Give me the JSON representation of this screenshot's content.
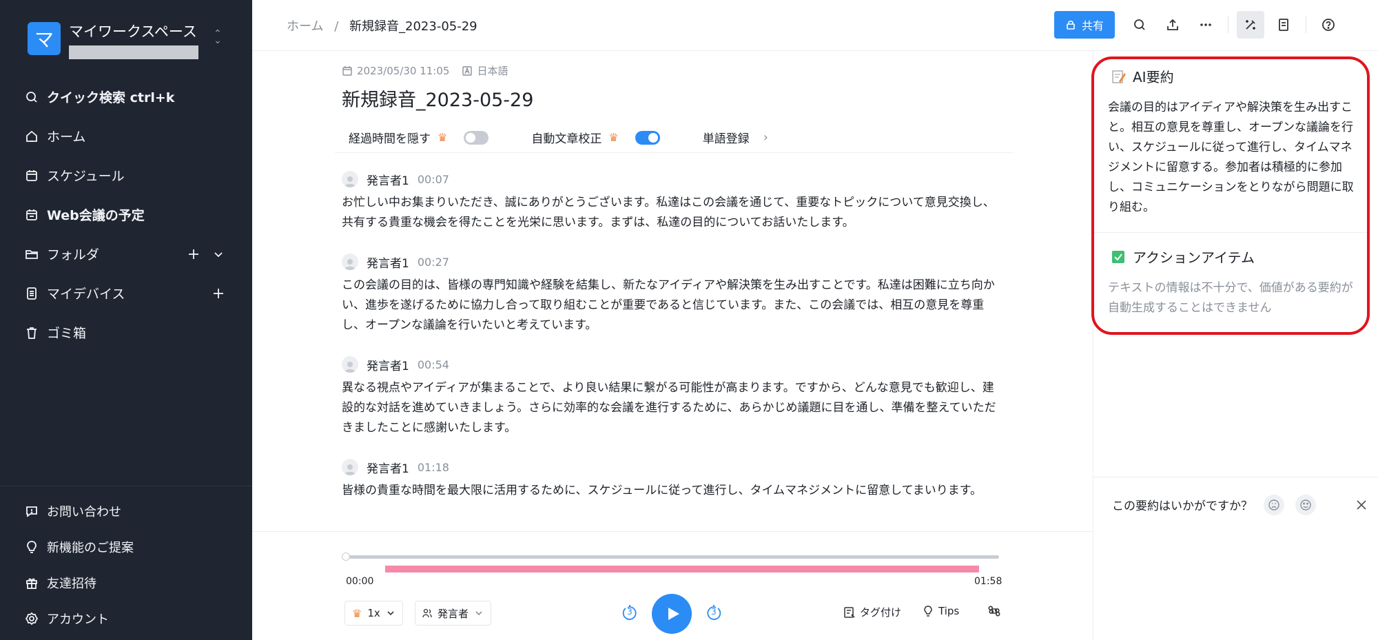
{
  "workspace": {
    "logo_char": "マ",
    "name": "マイワークスペース"
  },
  "sidebar": {
    "items": [
      {
        "label": "クイック検索 ctrl+k"
      },
      {
        "label": "ホーム"
      },
      {
        "label": "スケジュール"
      },
      {
        "label": "Web会議の予定"
      },
      {
        "label": "フォルダ"
      },
      {
        "label": "マイデバイス"
      },
      {
        "label": "ゴミ箱"
      }
    ],
    "bottom": [
      {
        "label": "お問い合わせ"
      },
      {
        "label": "新機能のご提案"
      },
      {
        "label": "友達招待"
      },
      {
        "label": "アカウント"
      }
    ]
  },
  "header": {
    "breadcrumb_home": "ホーム",
    "breadcrumb_sep": "/",
    "breadcrumb_current": "新規録音_2023-05-29",
    "share_label": "共有"
  },
  "doc": {
    "date": "2023/05/30 11:05",
    "language": "日本語",
    "title": "新規録音_2023-05-29",
    "options": {
      "hide_time": "経過時間を隠す",
      "hide_time_on": false,
      "auto_proofread": "自動文章校正",
      "auto_proofread_on": true,
      "word_register": "単語登録"
    },
    "segments": [
      {
        "speaker": "発言者1",
        "time": "00:07",
        "text": "お忙しい中お集まりいただき、誠にありがとうございます。私達はこの会議を通じて、重要なトピックについて意見交換し、共有する貴重な機会を得たことを光栄に思います。まずは、私達の目的についてお話いたします。"
      },
      {
        "speaker": "発言者1",
        "time": "00:27",
        "text": "この会議の目的は、皆様の専門知識や経験を結集し、新たなアイディアや解決策を生み出すことです。私達は困難に立ち向かい、進歩を遂げるために協力し合って取り組むことが重要であると信じています。また、この会議では、相互の意見を尊重し、オープンな議論を行いたいと考えています。"
      },
      {
        "speaker": "発言者1",
        "time": "00:54",
        "text": "異なる視点やアイディアが集まることで、より良い結果に繋がる可能性が高まります。ですから、どんな意見でも歓迎し、建設的な対話を進めていきましょう。さらに効率的な会議を進行するために、あらかじめ議題に目を通し、準備を整えていただきましたことに感謝いたします。"
      },
      {
        "speaker": "発言者1",
        "time": "01:18",
        "text": "皆様の貴重な時間を最大限に活用するために、スケジュールに従って進行し、タイムマネジメントに留意してまいります。"
      }
    ]
  },
  "player": {
    "progress": 0,
    "time_start": "00:00",
    "time_end": "01:58",
    "speed": "1x",
    "speaker_filter": "発言者",
    "skip_back": "3",
    "skip_forward": "3",
    "tag_label": "タグ付け",
    "tips_label": "Tips"
  },
  "ai_panel": {
    "summary_title": "AI要約",
    "summary_text": "会議の目的はアイディアや解決策を生み出すこと。相互の意見を尊重し、オープンな議論を行い、スケジュールに従って進行し、タイムマネジメントに留意する。参加者は積極的に参加し、コミュニケーションをとりながら問題に取り組む。",
    "action_title": "アクションアイテム",
    "action_text": "テキストの情報は不十分で、価値がある要約が自動生成することはできません",
    "feedback_question": "この要約はいかがですか？"
  },
  "colors": {
    "accent": "#2b8cf5",
    "sidebar_bg": "#1f2631",
    "highlight": "#e0141e",
    "speaker_bar": "#f48aa8"
  }
}
